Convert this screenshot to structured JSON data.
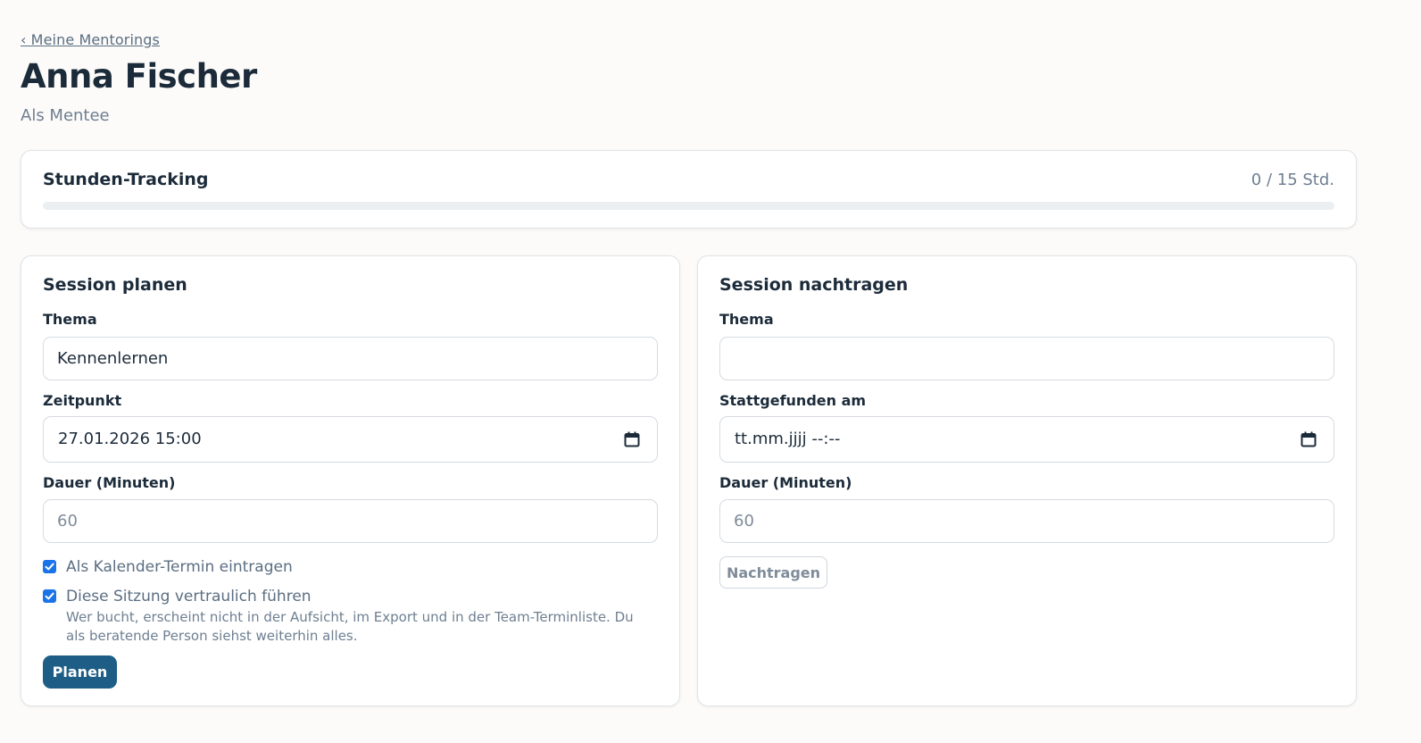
{
  "nav": {
    "back_link": "‹ Meine Mentorings"
  },
  "header": {
    "title": "Anna Fischer",
    "subtitle": "Als Mentee"
  },
  "tracking": {
    "title": "Stunden-Tracking",
    "value_text": "0 / 15 Std.",
    "hours_done": 0,
    "hours_total": 15
  },
  "plan": {
    "heading": "Session planen",
    "topic_label": "Thema",
    "topic_value": "Kennenlernen",
    "time_label": "Zeitpunkt",
    "time_value": "27.01.2026 15:00",
    "duration_label": "Dauer (Minuten)",
    "duration_placeholder": "60",
    "calendar_checkbox_label": "Als Kalender-Termin eintragen",
    "calendar_checked": true,
    "confidential_checkbox_label": "Diese Sitzung vertraulich führen",
    "confidential_checked": true,
    "confidential_hint": "Wer bucht, erscheint nicht in der Aufsicht, im Export und in der Team-Terminliste. Du als beratende Person siehst weiterhin alles.",
    "submit_label": "Planen"
  },
  "log": {
    "heading": "Session nachtragen",
    "topic_label": "Thema",
    "topic_value": "",
    "date_label": "Stattgefunden am",
    "date_placeholder": "tt.mm.jjjj --:--",
    "duration_label": "Dauer (Minuten)",
    "duration_placeholder": "60",
    "submit_label": "Nachtragen"
  },
  "colors": {
    "background": "#fcfbf9",
    "primary": "#1e5d86",
    "checkbox": "#1a73e8",
    "text": "#1c2b3a",
    "muted": "#6e7f91"
  },
  "icons": {
    "calendar": "calendar-icon",
    "checkmark": "check-icon"
  }
}
